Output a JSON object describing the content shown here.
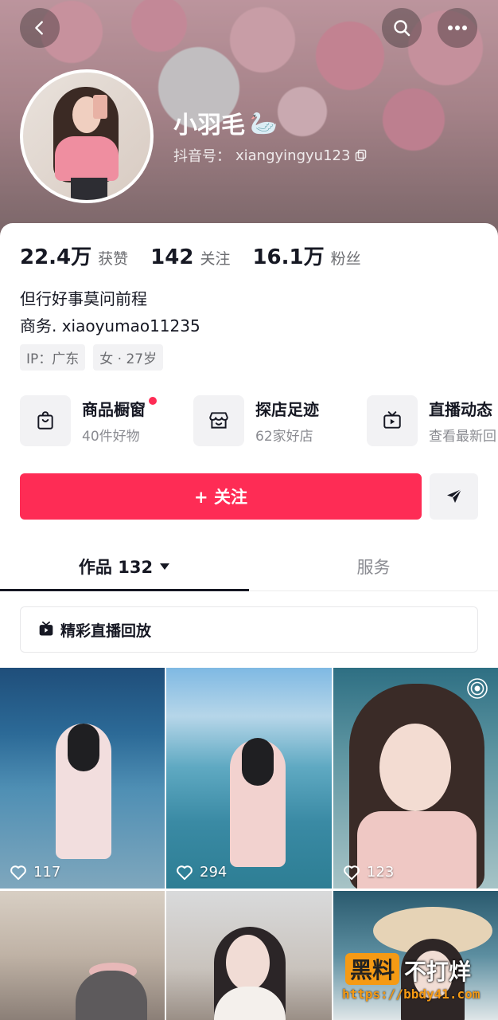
{
  "profile": {
    "name": "小羽毛",
    "name_emoji": "🦢",
    "douyin_id_label": "抖音号：",
    "douyin_id": "xiangyingyu123"
  },
  "stats": [
    {
      "value": "22.4万",
      "label": "获赞"
    },
    {
      "value": "142",
      "label": "关注"
    },
    {
      "value": "16.1万",
      "label": "粉丝"
    }
  ],
  "bio": {
    "line1": "但行好事莫问前程",
    "line2": "商务. xiaoyumao11235"
  },
  "tags": [
    {
      "text": "IP：广东"
    },
    {
      "text": "女 · 27岁"
    }
  ],
  "features": [
    {
      "title": "商品橱窗",
      "sub": "40件好物",
      "icon": "shopping-bag-icon"
    },
    {
      "title": "探店足迹",
      "sub": "62家好店",
      "icon": "store-icon"
    },
    {
      "title": "直播动态",
      "sub": "查看最新回",
      "icon": "tv-icon"
    }
  ],
  "actions": {
    "follow_label": "+ 关注"
  },
  "tabs": {
    "works_label": "作品 132",
    "service_label": "服务"
  },
  "live_replay_label": "精彩直播回放",
  "videos": [
    {
      "likes": "117"
    },
    {
      "likes": "294"
    },
    {
      "likes": "123"
    },
    {
      "likes": ""
    },
    {
      "likes": ""
    },
    {
      "likes": ""
    }
  ],
  "watermark": {
    "badge": "黑料",
    "text": "不打烊",
    "url": "https://bbdy41.com"
  },
  "colors": {
    "accent": "#fe2c55",
    "text_primary": "#161823",
    "text_secondary": "#8a8b91"
  }
}
